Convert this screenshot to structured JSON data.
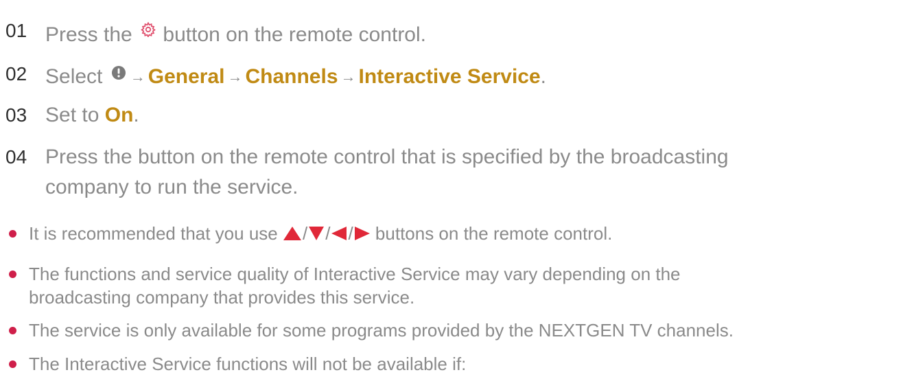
{
  "steps": [
    {
      "num": "01",
      "pre": "Press the",
      "icon": "gear-icon",
      "post": "button on the remote control."
    },
    {
      "num": "02",
      "pre": "Select",
      "icon": "info-icon",
      "arrow": "→",
      "path": [
        "General",
        "Channels",
        "Interactive Service"
      ],
      "post": "."
    },
    {
      "num": "03",
      "pre": "Set to",
      "value": "On",
      "post": "."
    },
    {
      "num": "04",
      "line1": "Press the button on the remote control that is specified by the broadcasting",
      "line2": "company to run the service."
    }
  ],
  "bullets": [
    {
      "pre": "It is recommended that you use",
      "icons": [
        "up-triangle-icon",
        "down-triangle-icon",
        "left-triangle-icon",
        "right-triangle-icon"
      ],
      "slash": "/",
      "post": "buttons on the remote control."
    },
    {
      "line1": "The functions and service quality of Interactive Service may vary depending on the",
      "line2": "broadcasting company that provides this service."
    },
    {
      "text": "The service is only available for some programs provided by the NEXTGEN TV channels."
    },
    {
      "text": "The Interactive Service functions will not be available if:"
    }
  ],
  "colors": {
    "text": "#8a8a8a",
    "number": "#2e2e2e",
    "highlight": "#c08a14",
    "bullet": "#cf1f4a",
    "gear": "#e0506e",
    "info": "#7a7a7a"
  }
}
